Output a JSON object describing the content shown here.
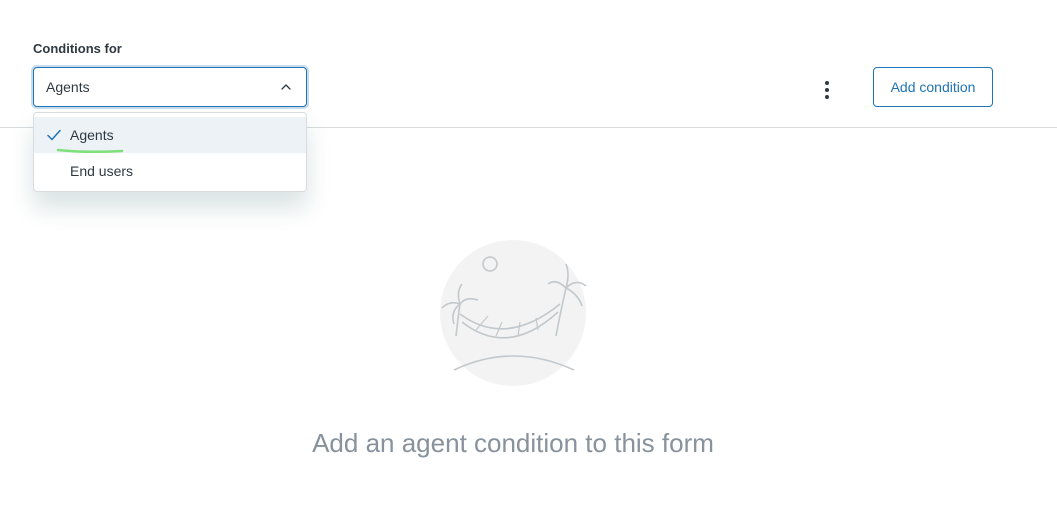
{
  "header": {
    "conditions_label": "Conditions for",
    "select_value": "Agents",
    "add_condition_label": "Add condition"
  },
  "dropdown": {
    "options": [
      {
        "label": "Agents",
        "selected": true
      },
      {
        "label": "End users",
        "selected": false
      }
    ]
  },
  "empty_state": {
    "message": "Add an agent condition to this form"
  },
  "colors": {
    "accent": "#1f73b7",
    "muted_text": "#87929d",
    "selected_bg": "#edf2f7",
    "highlight_mark": "#7ee07a"
  },
  "icons": {
    "select_chevron": "chevron-up-icon",
    "more": "kebab-icon",
    "selected_check": "check-icon",
    "empty_illustration": "hammock-island-illustration"
  }
}
